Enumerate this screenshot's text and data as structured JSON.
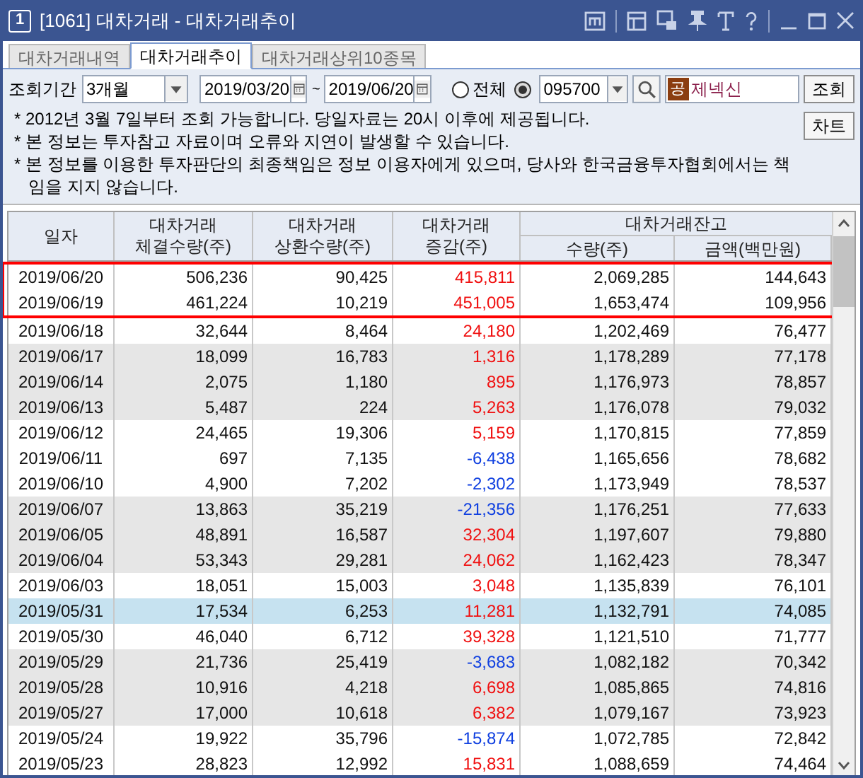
{
  "window": {
    "badge": "1",
    "title": "[1061] 대차거래 - 대차거래추이"
  },
  "tabs": [
    {
      "label": "대차거래내역",
      "selected": false
    },
    {
      "label": "대차거래추이",
      "selected": true
    },
    {
      "label": "대차거래상위10종목",
      "selected": false
    }
  ],
  "query": {
    "period_label": "조회기간",
    "period": "3개월",
    "start_date": "2019/03/20",
    "separator": "~",
    "end_date": "2019/06/20",
    "radios": [
      {
        "label": "전체",
        "selected": false
      },
      {
        "selected": true
      }
    ],
    "code": "095700",
    "stock_tag": "공",
    "stock_name": "제넥신",
    "buttons": [
      "조회",
      "차트"
    ]
  },
  "notes": [
    "* 2012년 3월 7일부터 조회 가능합니다. 당일자료는 20시 이후에 제공됩니다.",
    "* 본 정보는 투자참고 자료이며 오류와 지연이 발생할 수 있습니다.",
    "* 본 정보를 이용한 투자판단의 최종책임은 정보 이용자에게 있으며, 당사와 한국금융투자협회에서는 책임을 지지 않습니다."
  ],
  "table": {
    "columns": [
      "일자",
      "대차거래\n체결수량(주)",
      "대차거래\n상환수량(주)",
      "대차거래\n증감(주)"
    ],
    "group": {
      "label": "대차거래잔고",
      "columns": [
        "수량(주)",
        "금액(백만원)"
      ]
    },
    "rows": [
      {
        "cells": [
          "2019/06/20",
          "506,236",
          "90,425",
          "415,811",
          "2,069,285",
          "144,643"
        ],
        "color": "#f01010",
        "shaded": false,
        "selected": false,
        "highlighted": true
      },
      {
        "cells": [
          "2019/06/19",
          "461,224",
          "10,219",
          "451,005",
          "1,653,474",
          "109,956"
        ],
        "color": "#f01010",
        "shaded": false,
        "selected": false,
        "highlighted": true
      },
      {
        "cells": [
          "2019/06/18",
          "32,644",
          "8,464",
          "24,180",
          "1,202,469",
          "76,477"
        ],
        "color": "#f01010",
        "shaded": false,
        "selected": false,
        "highlighted": false
      },
      {
        "cells": [
          "2019/06/17",
          "18,099",
          "16,783",
          "1,316",
          "1,178,289",
          "77,178"
        ],
        "color": "#f01010",
        "shaded": true,
        "selected": false,
        "highlighted": false
      },
      {
        "cells": [
          "2019/06/14",
          "2,075",
          "1,180",
          "895",
          "1,176,973",
          "78,857"
        ],
        "color": "#f01010",
        "shaded": true,
        "selected": false,
        "highlighted": false
      },
      {
        "cells": [
          "2019/06/13",
          "5,487",
          "224",
          "5,263",
          "1,176,078",
          "79,032"
        ],
        "color": "#f01010",
        "shaded": true,
        "selected": false,
        "highlighted": false
      },
      {
        "cells": [
          "2019/06/12",
          "24,465",
          "19,306",
          "5,159",
          "1,170,815",
          "77,859"
        ],
        "color": "#f01010",
        "shaded": false,
        "selected": false,
        "highlighted": false
      },
      {
        "cells": [
          "2019/06/11",
          "697",
          "7,135",
          "-6,438",
          "1,165,656",
          "78,682"
        ],
        "color": "#1040e0",
        "shaded": false,
        "selected": false,
        "highlighted": false
      },
      {
        "cells": [
          "2019/06/10",
          "4,900",
          "7,202",
          "-2,302",
          "1,173,949",
          "78,537"
        ],
        "color": "#1040e0",
        "shaded": false,
        "selected": false,
        "highlighted": false
      },
      {
        "cells": [
          "2019/06/07",
          "13,863",
          "35,219",
          "-21,356",
          "1,176,251",
          "77,633"
        ],
        "color": "#1040e0",
        "shaded": true,
        "selected": false,
        "highlighted": false
      },
      {
        "cells": [
          "2019/06/05",
          "48,891",
          "16,587",
          "32,304",
          "1,197,607",
          "79,880"
        ],
        "color": "#f01010",
        "shaded": true,
        "selected": false,
        "highlighted": false
      },
      {
        "cells": [
          "2019/06/04",
          "53,343",
          "29,281",
          "24,062",
          "1,162,423",
          "78,347"
        ],
        "color": "#f01010",
        "shaded": true,
        "selected": false,
        "highlighted": false
      },
      {
        "cells": [
          "2019/06/03",
          "18,051",
          "15,003",
          "3,048",
          "1,135,839",
          "76,101"
        ],
        "color": "#f01010",
        "shaded": false,
        "selected": false,
        "highlighted": false
      },
      {
        "cells": [
          "2019/05/31",
          "17,534",
          "6,253",
          "11,281",
          "1,132,791",
          "74,085"
        ],
        "color": "#f01010",
        "selected": true,
        "highlighted": false
      },
      {
        "cells": [
          "2019/05/30",
          "46,040",
          "6,712",
          "39,328",
          "1,121,510",
          "71,777"
        ],
        "color": "#f01010",
        "shaded": false,
        "selected": false,
        "highlighted": false
      },
      {
        "cells": [
          "2019/05/29",
          "21,736",
          "25,419",
          "-3,683",
          "1,082,182",
          "70,342"
        ],
        "color": "#1040e0",
        "shaded": true,
        "selected": false,
        "highlighted": false
      },
      {
        "cells": [
          "2019/05/28",
          "10,916",
          "4,218",
          "6,698",
          "1,085,865",
          "74,816"
        ],
        "color": "#f01010",
        "shaded": true,
        "selected": false,
        "highlighted": false
      },
      {
        "cells": [
          "2019/05/27",
          "17,000",
          "10,618",
          "6,382",
          "1,079,167",
          "73,923"
        ],
        "color": "#f01010",
        "shaded": true,
        "selected": false,
        "highlighted": false
      },
      {
        "cells": [
          "2019/05/24",
          "19,922",
          "35,796",
          "-15,874",
          "1,072,785",
          "72,842"
        ],
        "color": "#1040e0",
        "shaded": false,
        "selected": false,
        "highlighted": false
      },
      {
        "cells": [
          "2019/05/23",
          "28,823",
          "12,992",
          "15,831",
          "1,088,659",
          "74,464"
        ],
        "color": "#f01010",
        "shaded": false,
        "selected": false,
        "highlighted": false
      }
    ]
  }
}
